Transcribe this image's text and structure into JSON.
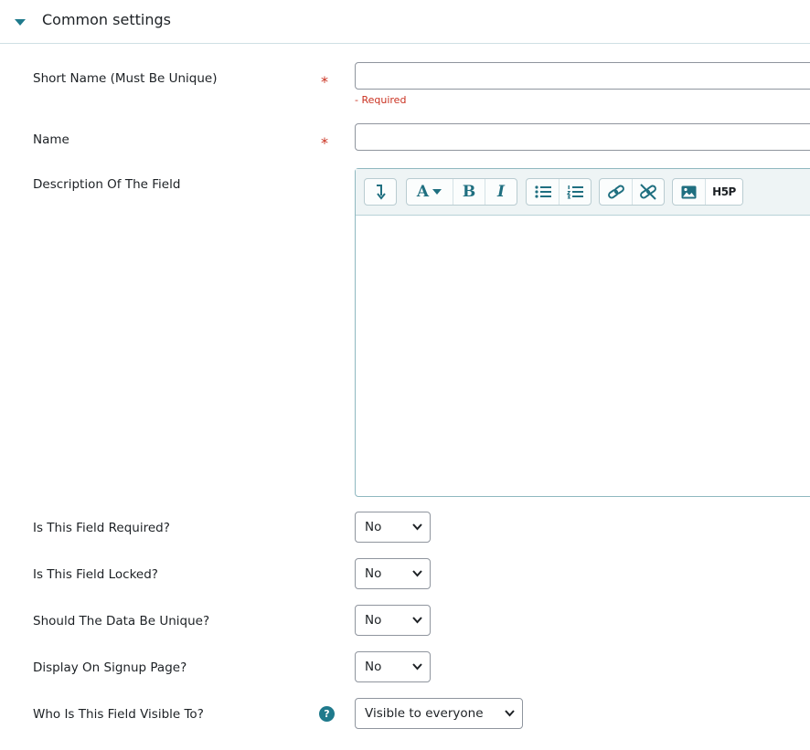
{
  "section": {
    "title": "Common settings"
  },
  "fields": {
    "shortname": {
      "label": "Short Name (Must Be Unique)",
      "value": "",
      "error": "- Required",
      "required_symbol": "*"
    },
    "name": {
      "label": "Name",
      "value": "",
      "required_symbol": "*"
    },
    "description": {
      "label": "Description Of The Field"
    },
    "required": {
      "label": "Is This Field Required?",
      "selected": "No"
    },
    "locked": {
      "label": "Is This Field Locked?",
      "selected": "No"
    },
    "unique": {
      "label": "Should The Data Be Unique?",
      "selected": "No"
    },
    "signup": {
      "label": "Display On Signup Page?",
      "selected": "No"
    },
    "visible": {
      "label": "Who Is This Field Visible To?",
      "selected": "Visible to everyone",
      "help_symbol": "?"
    }
  },
  "editor": {
    "toolbar": {
      "font_label": "A",
      "bold_label": "B",
      "italic_label": "I",
      "h5p_label": "H5P"
    }
  },
  "colors": {
    "accent": "#1f7a8c",
    "required": "#ca3120",
    "toolbar_bg": "#eef4f5"
  }
}
